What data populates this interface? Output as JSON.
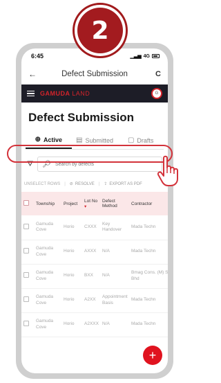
{
  "step": {
    "number": "2"
  },
  "statusbar": {
    "time": "6:45",
    "signal": "4G"
  },
  "titlebar": {
    "back_icon": "back-arrow-icon",
    "title": "Defect Submission",
    "refresh_icon": "refresh-icon"
  },
  "brandbar": {
    "brand_main": "GAMUDA",
    "brand_sub": "LAND",
    "avatar_initials": "G"
  },
  "page": {
    "title": "Defect Submission"
  },
  "tabs": [
    {
      "label": "Active",
      "icon": "circle-check-icon",
      "active": true
    },
    {
      "label": "Submitted",
      "icon": "clipboard-icon",
      "active": false
    },
    {
      "label": "Drafts",
      "icon": "file-icon",
      "active": false
    }
  ],
  "search": {
    "placeholder": "Search by defects"
  },
  "actions": {
    "unselect": "UNSELECT ROWS",
    "resolve": "RESOLVE",
    "export": "EXPORT AS PDF"
  },
  "table": {
    "columns": [
      "Township",
      "Project",
      "Lot No",
      "Defect Method",
      "Contractor"
    ],
    "rows": [
      [
        "Gamuda Cove",
        "Horio",
        "CXXX",
        "Key Handover",
        "Mada Techn"
      ],
      [
        "Gamuda Cove",
        "Horio",
        "AXXX",
        "N/A",
        "Mada Techn"
      ],
      [
        "Gamuda Cove",
        "Horio",
        "BXX",
        "N/A",
        "Bmag Cons. (M) Sdn Bhd"
      ],
      [
        "Gamuda Cove",
        "Horio",
        "A2XX",
        "Appointment Basis",
        "Mada Techn"
      ],
      [
        "Gamuda Cove",
        "Horio",
        "A2XXX",
        "N/A",
        "Mada Techn"
      ]
    ]
  },
  "colors": {
    "accent": "#d3232a",
    "brandbar": "#1d1d27",
    "header_row": "#fbe7e8",
    "badge": "#a31b1f"
  }
}
